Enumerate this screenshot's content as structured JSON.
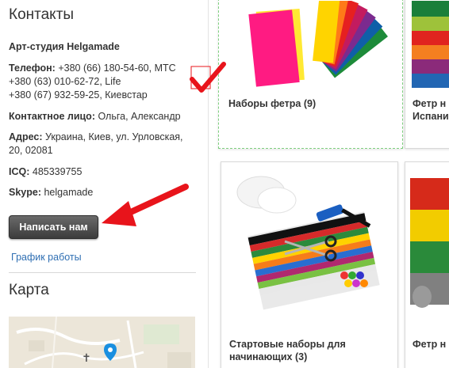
{
  "sidebar": {
    "contacts_title": "Контакты",
    "studio_name": "Арт-студия Helgamade",
    "phone_label": "Телефон:",
    "phones": [
      "+380 (66) 180-54-60, МТС",
      "+380 (63) 010-62-72, Life",
      "+380 (67) 932-59-25, Киевстар"
    ],
    "contact_person_label": "Контактное лицо:",
    "contact_person": "Ольга, Александр",
    "address_label": "Адрес:",
    "address_line1": "Украина, Киев, ул. Урловская,",
    "address_line2": "20, 02081",
    "icq_label": "ICQ:",
    "icq": "485339755",
    "skype_label": "Skype:",
    "skype": "helgamade",
    "write_button": "Написать нам",
    "schedule_link": "График работы",
    "map_title": "Карта"
  },
  "products": [
    {
      "name": "Наборы фетра",
      "count": "(9)"
    },
    {
      "name_line1": "Фетр н",
      "name_line2": "Испани"
    },
    {
      "name_line1": "Стартовые наборы для",
      "name_line2": "начинающих",
      "count": "(3)"
    },
    {
      "name_line1": "Фетр н"
    }
  ],
  "colors": {
    "accent_link": "#2f6fb3",
    "annotation_red": "#e8141b",
    "selected_border": "#7fcf7f"
  }
}
